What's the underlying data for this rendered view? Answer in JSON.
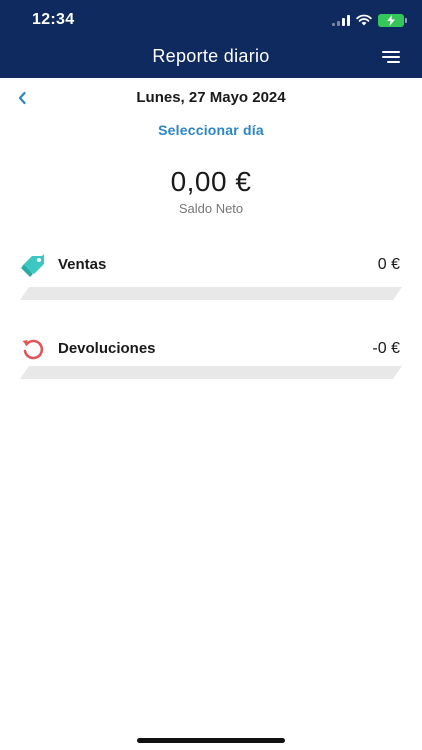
{
  "status_bar": {
    "time": "12:34"
  },
  "header": {
    "title": "Reporte diario"
  },
  "date_nav": {
    "date": "Lunes, 27 Mayo 2024",
    "select_day": "Seleccionar día"
  },
  "balance": {
    "value": "0,00 €",
    "label": "Saldo Neto"
  },
  "rows": [
    {
      "label": "Ventas",
      "amount": "0 €",
      "icon": "price-tag-icon",
      "color": "#3cc7c2",
      "progress": 0
    },
    {
      "label": "Devoluciones",
      "amount": "-0 €",
      "icon": "refund-arrow-icon",
      "color": "#e0575b",
      "progress": 0
    }
  ],
  "colors": {
    "header_bg": "#0f2a5e",
    "accent": "#2a86c4",
    "battery": "#34c759"
  }
}
